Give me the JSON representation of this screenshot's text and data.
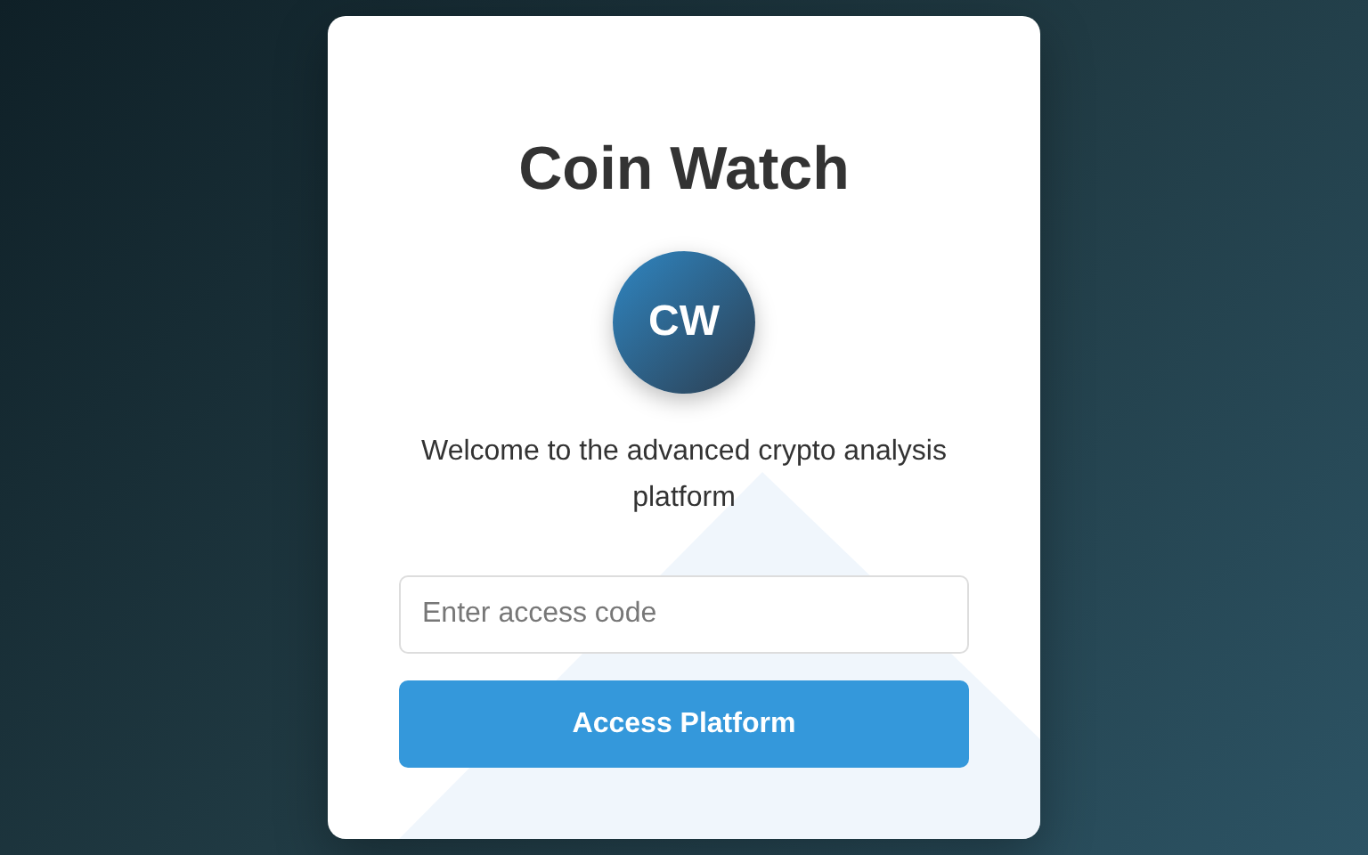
{
  "title": "Coin Watch",
  "logo": {
    "text": "CW"
  },
  "welcome": "Welcome to the advanced crypto analysis platform",
  "access_code": {
    "placeholder": "Enter access code"
  },
  "button": "Access Platform"
}
